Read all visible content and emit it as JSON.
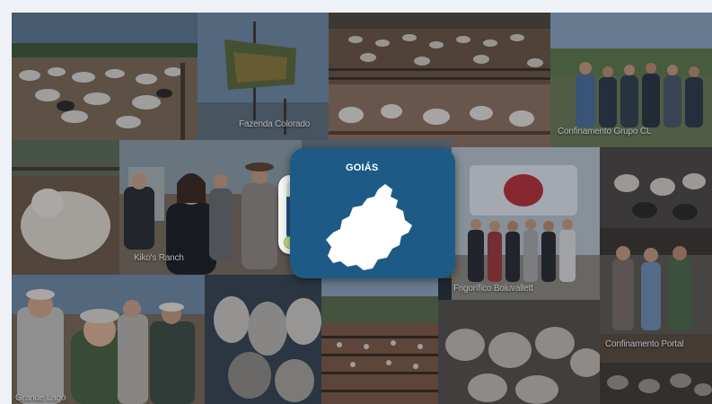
{
  "card": {
    "title": "GOIÁS",
    "background_color": "#1d5b86",
    "map_icon": "goias-state-map-icon",
    "map_color": "#ffffff"
  },
  "gauge": {
    "icon": "thermometer-icon",
    "fill_fraction": 0.75,
    "fill_color": "#25507d",
    "bulb_color": "#c6dc86"
  },
  "captions": {
    "fazenda": "Fazenda Colorado",
    "confinamento_grupo": "Confinamento Grupo CL",
    "kiko": "Kiko's Ranch",
    "frigorifico": "Frigorífico Boiuvallett",
    "confinamento_portal": "Confinamento Portal",
    "grande_lago": "Grande Lago"
  }
}
